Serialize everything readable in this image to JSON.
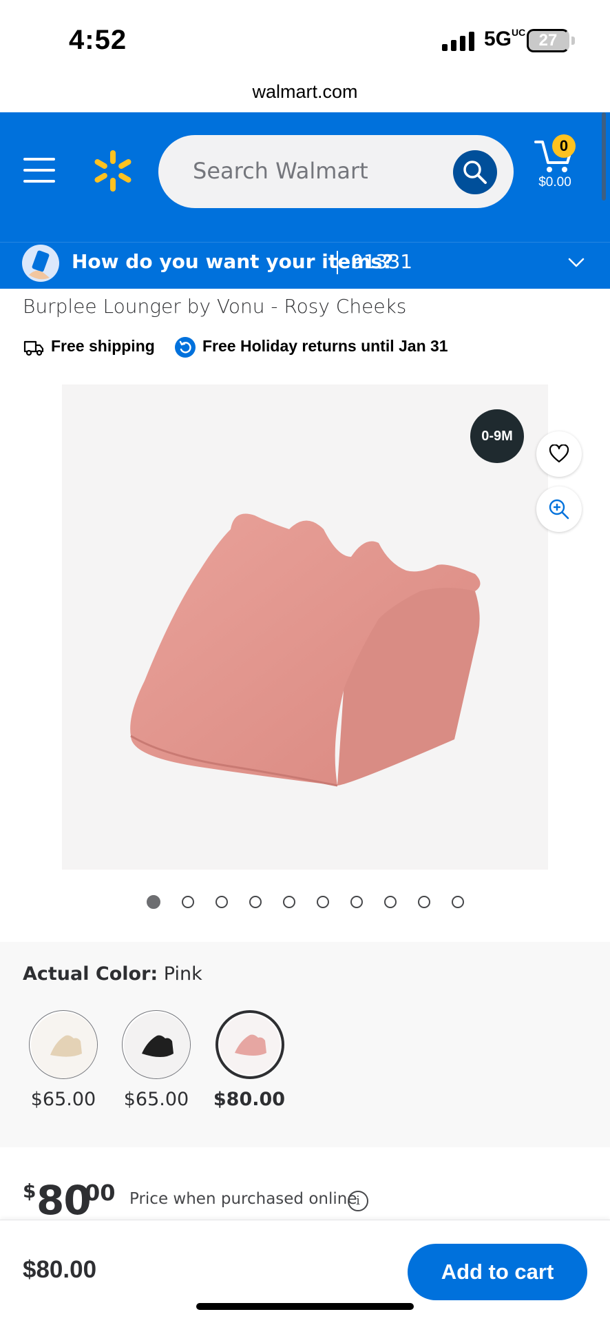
{
  "status_bar": {
    "time": "4:52",
    "network": "5G",
    "network_suffix": "UC",
    "battery": "27"
  },
  "browser": {
    "url": "walmart.com"
  },
  "header": {
    "search_placeholder": "Search Walmart",
    "cart_count": "0",
    "cart_total": "$0.00",
    "brand_color": "#0071dc",
    "spark_color": "#ffc220"
  },
  "fulfillment": {
    "question": "How do you want your items?",
    "zip": "91331"
  },
  "product": {
    "title": "Burplee Lounger by Vonu - Rosy Cheeks",
    "shipping": "Free shipping",
    "returns": "Free Holiday returns until Jan 31",
    "age_badge": "0-9M",
    "image_count": 10,
    "active_image": 1
  },
  "variants": {
    "label": "Actual Color:",
    "value": "Pink",
    "options": [
      {
        "price": "$65.00",
        "color": "#e4d2b6",
        "selected": false
      },
      {
        "price": "$65.00",
        "color": "#1f1f1f",
        "selected": false
      },
      {
        "price": "$80.00",
        "color": "#e6a6a2",
        "selected": true
      }
    ]
  },
  "price": {
    "currency": "$",
    "whole": "80",
    "cents": "00",
    "note": "Price when purchased online"
  },
  "bottom_bar": {
    "price": "$80.00",
    "add_to_cart": "Add to cart"
  }
}
